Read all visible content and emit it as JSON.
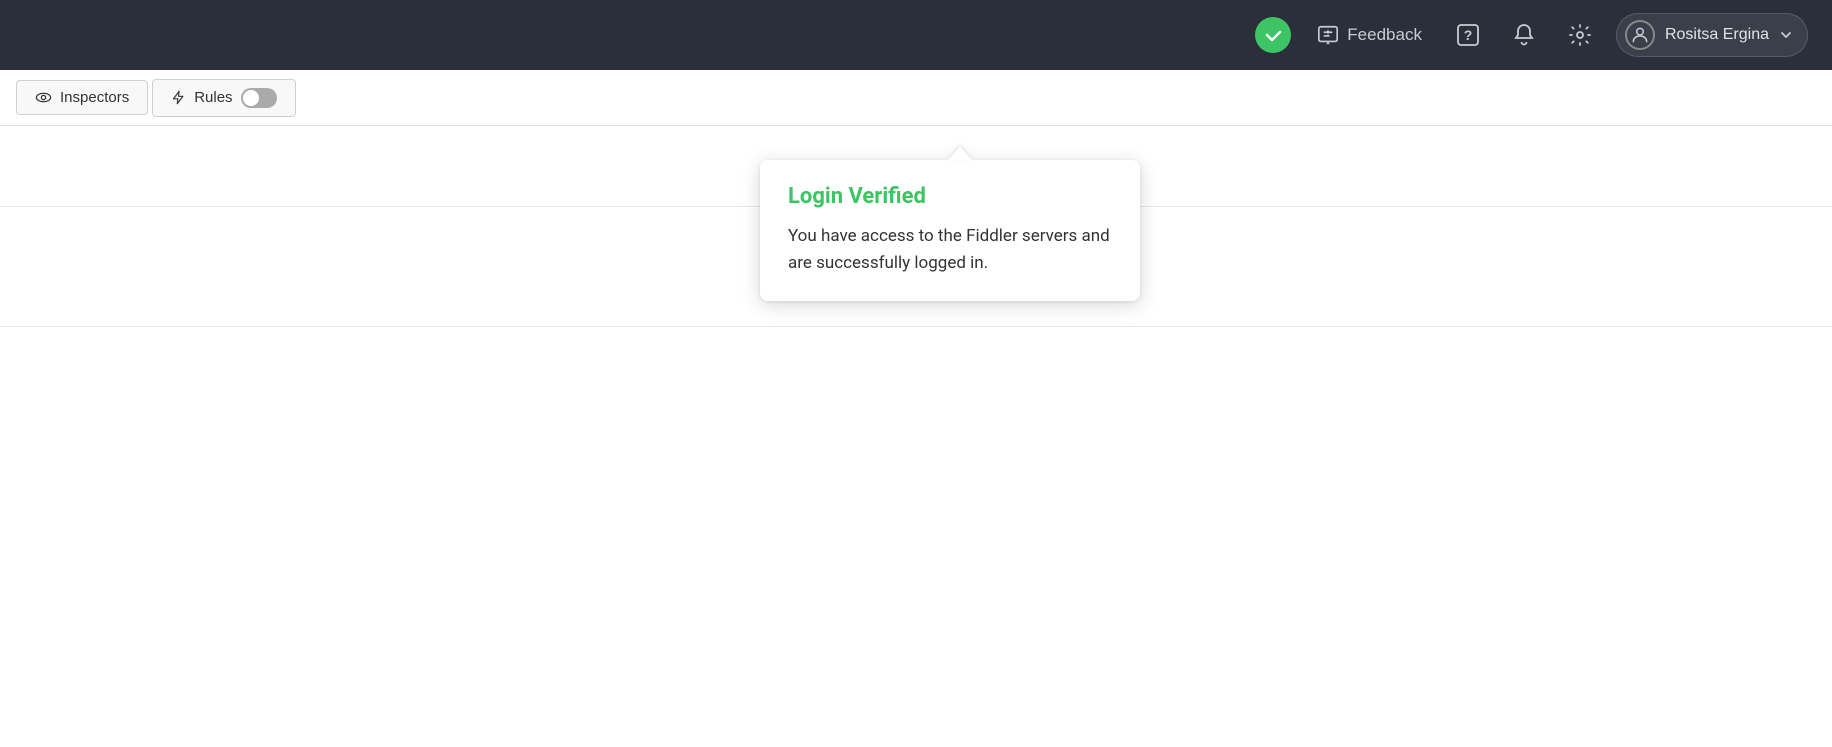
{
  "navbar": {
    "verified_status": "verified",
    "feedback_label": "Feedback",
    "help_icon": "question-mark-icon",
    "notification_icon": "bell-icon",
    "settings_icon": "gear-icon",
    "user_name": "Rositsa Ergina",
    "dropdown_icon": "chevron-down-icon",
    "user_icon": "person-icon"
  },
  "subtoolbar": {
    "inspectors_label": "Inspectors",
    "inspectors_icon": "eye-icon",
    "rules_label": "Rules",
    "rules_icon": "bolt-icon",
    "toggle_state": "off"
  },
  "popup": {
    "title": "Login Verified",
    "body": "You have access to the Fiddler servers and are successfully logged in."
  }
}
